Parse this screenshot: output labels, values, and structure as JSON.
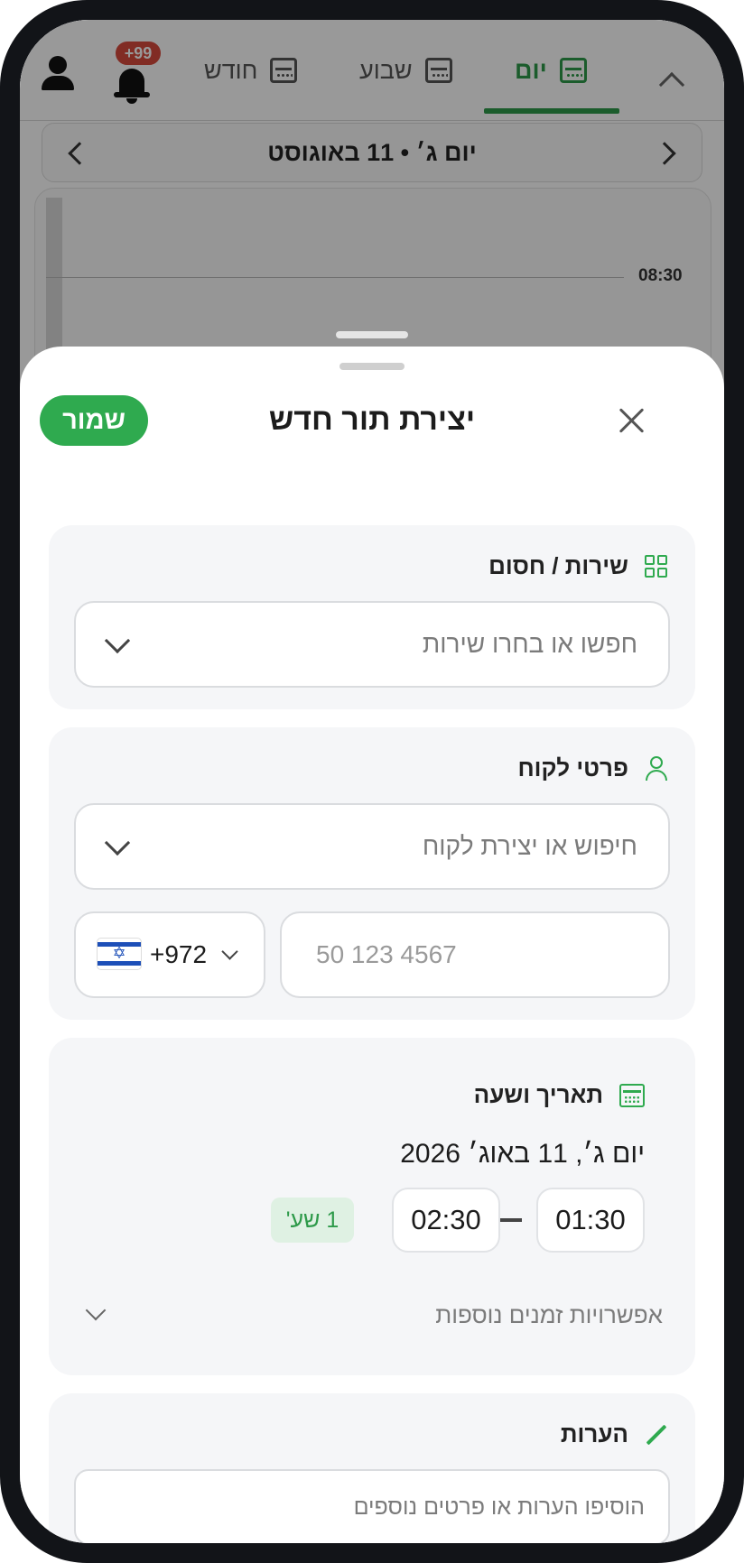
{
  "calendar": {
    "tabs": [
      {
        "label": "יום",
        "active": true
      },
      {
        "label": "שבוע",
        "active": false
      },
      {
        "label": "חודש",
        "active": false
      }
    ],
    "notifications_badge": "+99",
    "date_label": "יום ג׳  •  11 באוגוסט",
    "time_label": "08:30"
  },
  "sheet": {
    "title": "יצירת תור חדש",
    "save_label": "שמור",
    "service": {
      "title": "שירות / חסום",
      "placeholder": "חפשו או בחרו שירות"
    },
    "customer": {
      "title": "פרטי לקוח",
      "placeholder": "חיפוש או יצירת לקוח",
      "country_code": "+972",
      "phone_placeholder": "50 123 4567"
    },
    "datetime": {
      "title": "תאריך ושעה",
      "date": "יום ג׳, 11 באוג׳ 2026",
      "start": "01:30",
      "end": "02:30",
      "duration": "1 שע'",
      "more_options": "אפשרויות זמנים נוספות"
    },
    "notes": {
      "title": "הערות",
      "placeholder": "הוסיפו הערות או פרטים נוספים"
    }
  },
  "colors": {
    "accent": "#2faa4f",
    "badge": "#d84a3c",
    "card_bg": "#f5f6f8"
  }
}
